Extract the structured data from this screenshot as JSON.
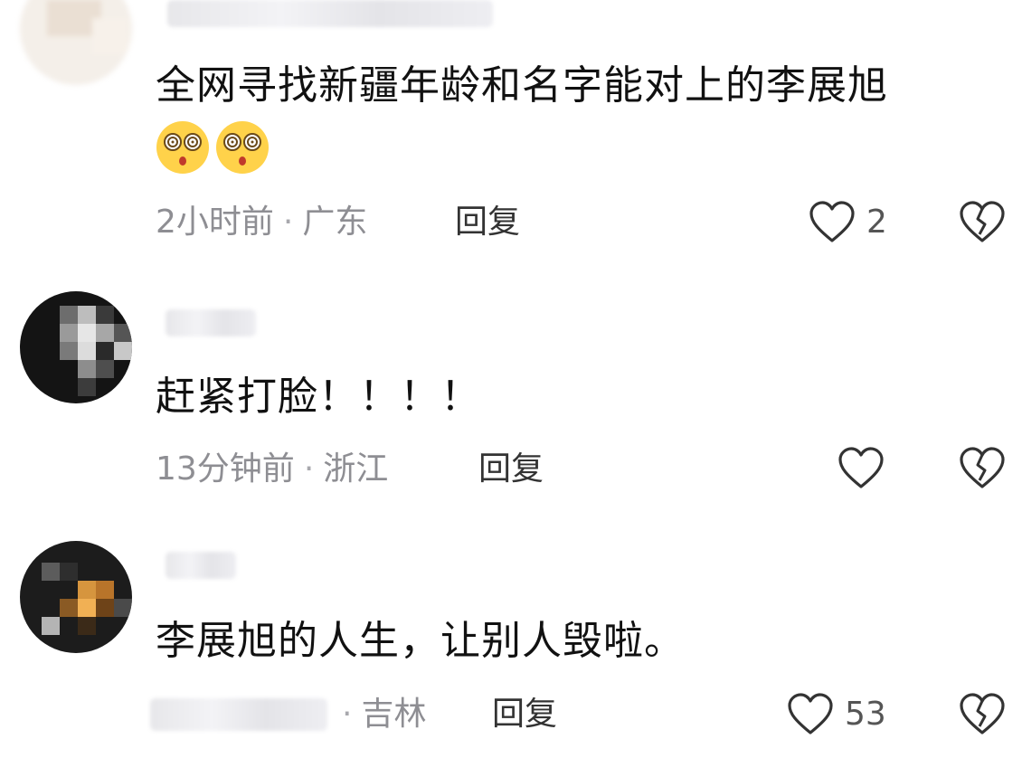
{
  "comments": [
    {
      "text": "全网寻找新疆年龄和名字能对上的李展旭",
      "emoji_count": 2,
      "emoji_icon": "dizzy-face-emoji",
      "time": "2小时前",
      "location": "广东",
      "reply_label": "回复",
      "like_count": "2"
    },
    {
      "text": "赶紧打脸！！！！",
      "time": "13分钟前",
      "location": "浙江",
      "reply_label": "回复",
      "like_count": ""
    },
    {
      "text": "李展旭的人生，让别人毁啦。",
      "time": "",
      "location": "吉林",
      "reply_label": "回复",
      "like_count": "53"
    }
  ],
  "icons": {
    "like": "heart-outline-icon",
    "dislike": "broken-heart-icon"
  },
  "colors": {
    "text": "#111111",
    "meta": "#8e8e93",
    "icon_stroke": "#333333",
    "emoji_face": "#ffd24a"
  }
}
